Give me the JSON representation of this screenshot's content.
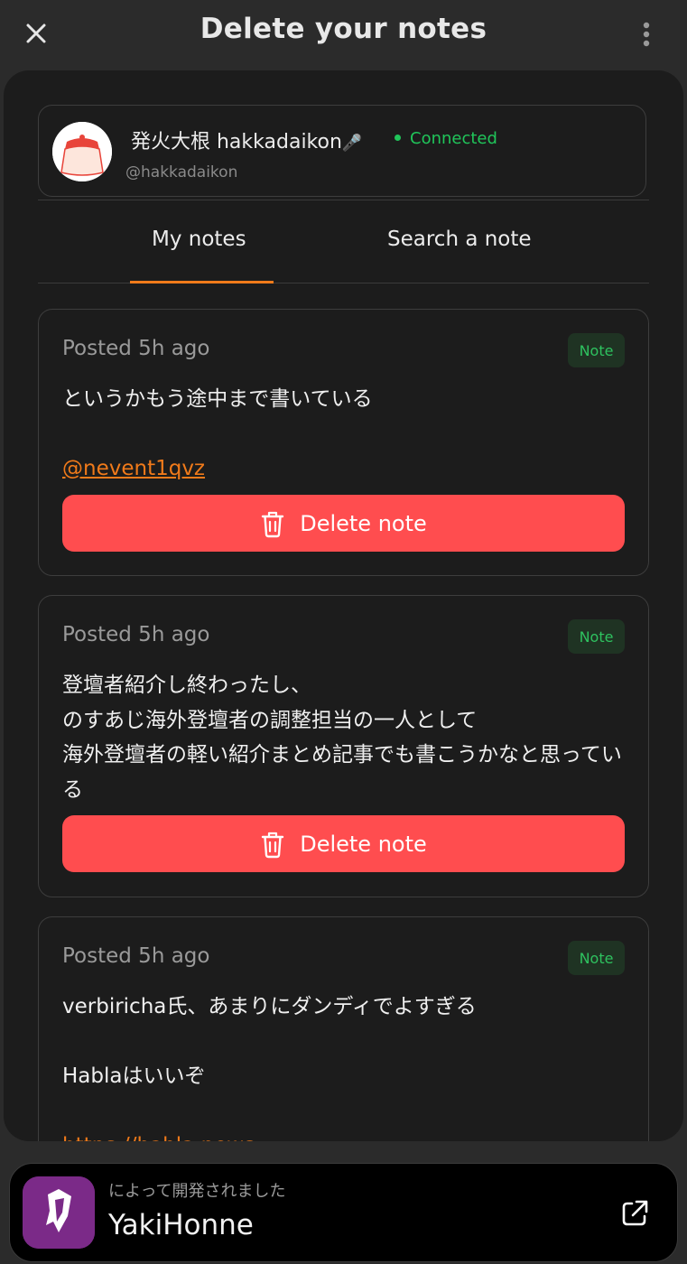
{
  "header": {
    "title": "Delete your notes"
  },
  "profile": {
    "display_name": "発火大根 hakkadaikon",
    "mic_glyph": "🎤",
    "status": "Connected",
    "handle": "@hakkadaikon"
  },
  "tabs": [
    {
      "label": "My notes",
      "active": true
    },
    {
      "label": "Search a note",
      "active": false
    }
  ],
  "notes": [
    {
      "posted": "Posted 5h ago",
      "badge": "Note",
      "text": "というかもう途中まで書いている\n\n",
      "link": "@nevent1qvz",
      "delete_label": "Delete note"
    },
    {
      "posted": "Posted 5h ago",
      "badge": "Note",
      "text": "登壇者紹介し終わったし、\nのすあじ海外登壇者の調整担当の一人として\n海外登壇者の軽い紹介まとめ記事でも書こうかなと思っている",
      "delete_label": "Delete note"
    },
    {
      "posted": "Posted 5h ago",
      "badge": "Note",
      "text": "verbiricha氏、あまりにダンディでよすぎる\n\nHablaはいいぞ\n\n",
      "link": "https://habla.news"
    }
  ],
  "footer": {
    "subtitle": "によって開発されました",
    "app_name": "YakiHonne"
  },
  "colors": {
    "accent": "#f07a1a",
    "danger": "#ff4d4f",
    "connected": "#20c55a",
    "badge_bg": "#1f3323",
    "badge_text": "#2ec25f"
  }
}
